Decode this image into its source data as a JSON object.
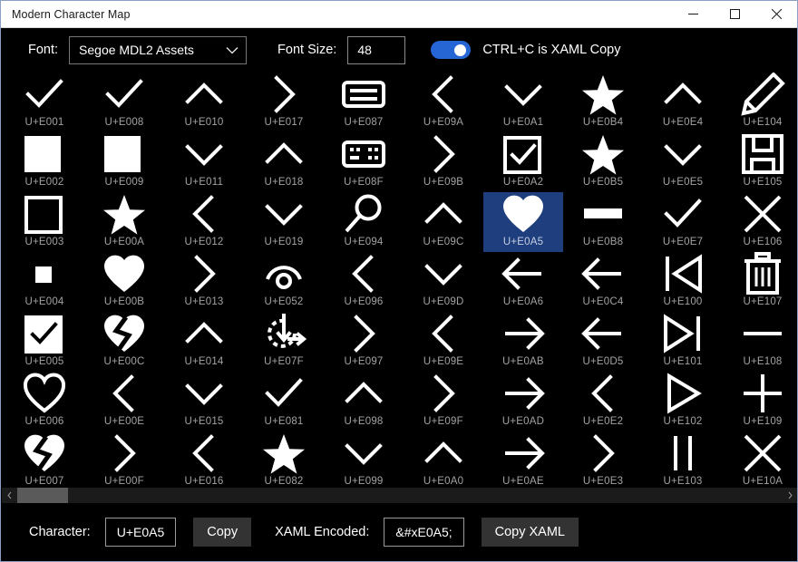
{
  "window": {
    "title": "Modern Character Map",
    "controls": [
      {
        "name": "minimize",
        "glyph": "minimize-icon"
      },
      {
        "name": "maximize",
        "glyph": "maximize-icon"
      },
      {
        "name": "close",
        "glyph": "close-icon"
      }
    ]
  },
  "toolbar": {
    "font_label": "Font:",
    "font_value": "Segoe MDL2 Assets",
    "font_chevron": "chevron-down-icon",
    "size_label": "Font Size:",
    "size_value": "48",
    "toggle_on": true,
    "toggle_label": "CTRL+C is XAML Copy",
    "accent_color": "#2665d4"
  },
  "grid": {
    "selected_code": "U+E0A5",
    "selection_color": "#1f3e7d",
    "columns": 10,
    "cells": [
      {
        "code": "U+E001",
        "icon": "checkmark-icon"
      },
      {
        "code": "U+E008",
        "icon": "checkmark-icon"
      },
      {
        "code": "U+E010",
        "icon": "chevron-up-icon"
      },
      {
        "code": "U+E017",
        "icon": "chevron-right-icon"
      },
      {
        "code": "U+E087",
        "icon": "keyboard-icon"
      },
      {
        "code": "U+E09A",
        "icon": "chevron-left-icon"
      },
      {
        "code": "U+E0A1",
        "icon": "chevron-down-icon"
      },
      {
        "code": "U+E0B4",
        "icon": "star-filled-icon"
      },
      {
        "code": "U+E0E4",
        "icon": "chevron-up-icon"
      },
      {
        "code": "U+E104",
        "icon": "pencil-icon"
      },
      {
        "code": "U+E002",
        "icon": "square-filled-icon"
      },
      {
        "code": "U+E009",
        "icon": "square-filled-icon"
      },
      {
        "code": "U+E011",
        "icon": "chevron-down-icon"
      },
      {
        "code": "U+E018",
        "icon": "chevron-up-icon"
      },
      {
        "code": "U+E08F",
        "icon": "keyboard-split-icon"
      },
      {
        "code": "U+E09B",
        "icon": "chevron-right-icon"
      },
      {
        "code": "U+E0A2",
        "icon": "checkbox-checked-icon"
      },
      {
        "code": "U+E0B5",
        "icon": "star-filled-icon"
      },
      {
        "code": "U+E0E5",
        "icon": "chevron-down-icon"
      },
      {
        "code": "U+E105",
        "icon": "save-icon"
      },
      {
        "code": "U+E003",
        "icon": "square-outline-icon"
      },
      {
        "code": "U+E00A",
        "icon": "star-filled-icon"
      },
      {
        "code": "U+E012",
        "icon": "chevron-left-icon"
      },
      {
        "code": "U+E019",
        "icon": "chevron-down-icon"
      },
      {
        "code": "U+E094",
        "icon": "search-icon"
      },
      {
        "code": "U+E09C",
        "icon": "chevron-up-icon"
      },
      {
        "code": "U+E0A5",
        "icon": "heart-filled-icon"
      },
      {
        "code": "U+E0B8",
        "icon": "rectangle-bar-icon"
      },
      {
        "code": "U+E0E7",
        "icon": "checkmark-icon"
      },
      {
        "code": "U+E106",
        "icon": "cancel-x-icon"
      },
      {
        "code": "U+E004",
        "icon": "small-square-filled-icon"
      },
      {
        "code": "U+E00B",
        "icon": "heart-filled-icon"
      },
      {
        "code": "U+E013",
        "icon": "chevron-right-icon"
      },
      {
        "code": "U+E052",
        "icon": "arc-circle-icon"
      },
      {
        "code": "U+E096",
        "icon": "chevron-left-icon"
      },
      {
        "code": "U+E09D",
        "icon": "chevron-down-icon"
      },
      {
        "code": "U+E0A6",
        "icon": "arrow-left-icon"
      },
      {
        "code": "U+E0C4",
        "icon": "arrow-left-icon"
      },
      {
        "code": "U+E100",
        "icon": "previous-track-icon"
      },
      {
        "code": "U+E107",
        "icon": "delete-icon"
      },
      {
        "code": "U+E005",
        "icon": "checkbox-filled-checked-icon"
      },
      {
        "code": "U+E00C",
        "icon": "heart-broken-icon"
      },
      {
        "code": "U+E014",
        "icon": "chevron-up-icon"
      },
      {
        "code": "U+E07F",
        "icon": "download-circle-icon"
      },
      {
        "code": "U+E097",
        "icon": "chevron-right-icon"
      },
      {
        "code": "U+E09E",
        "icon": "chevron-left-icon"
      },
      {
        "code": "U+E0AB",
        "icon": "arrow-right-icon"
      },
      {
        "code": "U+E0D5",
        "icon": "arrow-left-icon"
      },
      {
        "code": "U+E101",
        "icon": "next-track-icon"
      },
      {
        "code": "U+E108",
        "icon": "horizontal-line-icon"
      },
      {
        "code": "U+E006",
        "icon": "heart-outline-icon"
      },
      {
        "code": "U+E00E",
        "icon": "chevron-left-icon"
      },
      {
        "code": "U+E015",
        "icon": "chevron-down-icon"
      },
      {
        "code": "U+E081",
        "icon": "checkmark-icon"
      },
      {
        "code": "U+E098",
        "icon": "chevron-up-icon"
      },
      {
        "code": "U+E09F",
        "icon": "chevron-right-icon"
      },
      {
        "code": "U+E0AD",
        "icon": "arrow-right-icon"
      },
      {
        "code": "U+E0E2",
        "icon": "chevron-left-icon"
      },
      {
        "code": "U+E102",
        "icon": "play-icon"
      },
      {
        "code": "U+E109",
        "icon": "plus-icon"
      },
      {
        "code": "U+E007",
        "icon": "heart-broken-icon"
      },
      {
        "code": "U+E00F",
        "icon": "chevron-right-icon"
      },
      {
        "code": "U+E016",
        "icon": "chevron-left-icon"
      },
      {
        "code": "U+E082",
        "icon": "star-filled-icon"
      },
      {
        "code": "U+E099",
        "icon": "chevron-down-icon"
      },
      {
        "code": "U+E0A0",
        "icon": "chevron-up-icon"
      },
      {
        "code": "U+E0AE",
        "icon": "arrow-right-icon"
      },
      {
        "code": "U+E0E3",
        "icon": "chevron-right-icon"
      },
      {
        "code": "U+E103",
        "icon": "pause-icon"
      },
      {
        "code": "U+E10A",
        "icon": "cancel-x-icon"
      }
    ]
  },
  "scrollbar": {
    "left_arrow": "chevron-left-icon",
    "right_arrow": "chevron-right-icon"
  },
  "bottombar": {
    "character_label": "Character:",
    "character_value": "U+E0A5",
    "copy_label": "Copy",
    "xaml_label": "XAML Encoded:",
    "xaml_value": "&#xE0A5;",
    "copy_xaml_label": "Copy XAML"
  }
}
